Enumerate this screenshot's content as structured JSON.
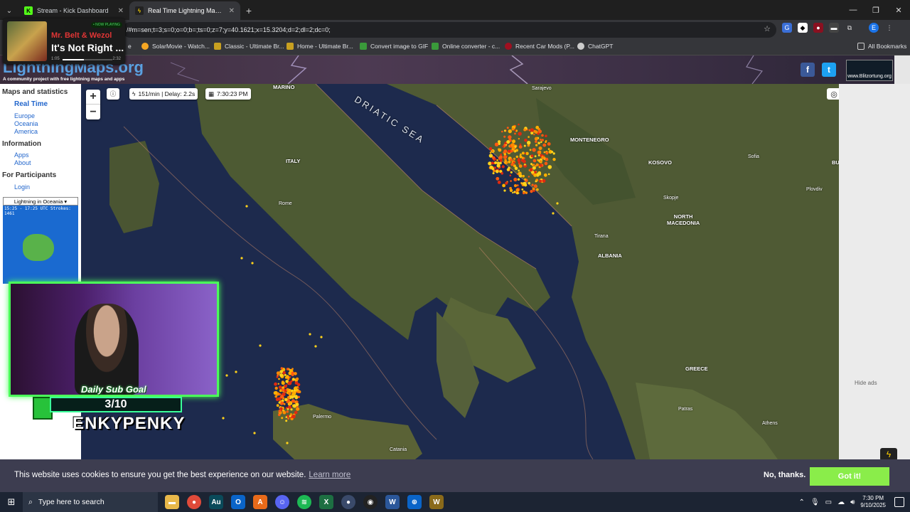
{
  "browser": {
    "tabs": [
      {
        "title": "Stream - Kick Dashboard",
        "favicon": "kick-icon",
        "color": "#53fc18",
        "active": false
      },
      {
        "title": "Real Time Lightning Map :: Ligh",
        "favicon": "lightning-icon",
        "color": "#f7d000",
        "active": true
      }
    ],
    "url": "/#m=sen;t=3;s=0;o=0;b=;ts=0;z=7;y=40.1621;x=15.3204;d=2;dl=2;dc=0;",
    "bookmarks": [
      {
        "label": "SolarMovie - Watch...",
        "color": "#f5a623"
      },
      {
        "label": "Classic - Ultimate Br...",
        "color": "#c8a020"
      },
      {
        "label": "Home - Ultimate Br...",
        "color": "#c8a020"
      },
      {
        "label": "Convert image to GIF",
        "color": "#3a9a3a"
      },
      {
        "label": "Online converter - c...",
        "color": "#3a9a3a"
      },
      {
        "label": "Recent Car Mods (P...",
        "color": "#a01020"
      },
      {
        "label": "ChatGPT",
        "color": "#cccccc"
      }
    ],
    "all_bookmarks": "All Bookmarks",
    "bookmark_partial": "e"
  },
  "now_playing": {
    "badge": "• NOW PLAYING",
    "artist": "Mr. Belt & Wezol",
    "song": "It's Not Right ...",
    "elapsed": "1:05",
    "duration": "2:32",
    "progress": 0.43
  },
  "site": {
    "logo": "LightningMaps.org",
    "tagline": "A community project with free lightning maps and apps",
    "blitz": "www.Blitzortung.org"
  },
  "sidebar": {
    "maps_heading": "Maps and statistics",
    "real_time": "Real Time",
    "regions": [
      "Europe",
      "Oceania",
      "America"
    ],
    "info_heading": "Information",
    "info_links": [
      "Apps",
      "About"
    ],
    "participants_heading": "For Participants",
    "login": "Login",
    "select_value": "Lightning in Oceania",
    "minimap_caption": "15:25 - 17:25 UTC Strokes: 1461"
  },
  "map": {
    "rate": "151/min | Delay: 2.2s",
    "time": "7:30:23 PM",
    "zoom_in": "+",
    "zoom_out": "−",
    "labels": {
      "marino": "MARINO",
      "sarajevo": "Sarajevo",
      "montenegro": "MONTENEGRO",
      "kosovo": "KOSOVO",
      "sofia": "Sofia",
      "bu": "BU",
      "plovdiv": "Plovdiv",
      "skopje": "Skopje",
      "north_macedonia": "NORTH\nMACEDONIA",
      "tirana": "Tirana",
      "albania": "ALBANIA",
      "italy": "ITALY",
      "rome": "Rome",
      "greece": "GREECE",
      "patras": "Patras",
      "athens": "Athens",
      "palermo": "Palermo",
      "catania": "Catania",
      "adriatic": "DRIATIC SEA"
    }
  },
  "ads": {
    "hide": "Hide ads"
  },
  "overlay": {
    "sub_goal_label": "Daily Sub Goal",
    "sub_goal_count": "3/10",
    "streamer": "ENKYPENKY"
  },
  "cookie": {
    "message": "This website uses cookies to ensure you get the best experience on our website.",
    "learn_more": "Learn more",
    "decline": "No, thanks.",
    "accept": "Got it!"
  },
  "taskbar": {
    "search_placeholder": "Type here to search",
    "time": "7:30 PM",
    "date": "9/10/2025"
  }
}
